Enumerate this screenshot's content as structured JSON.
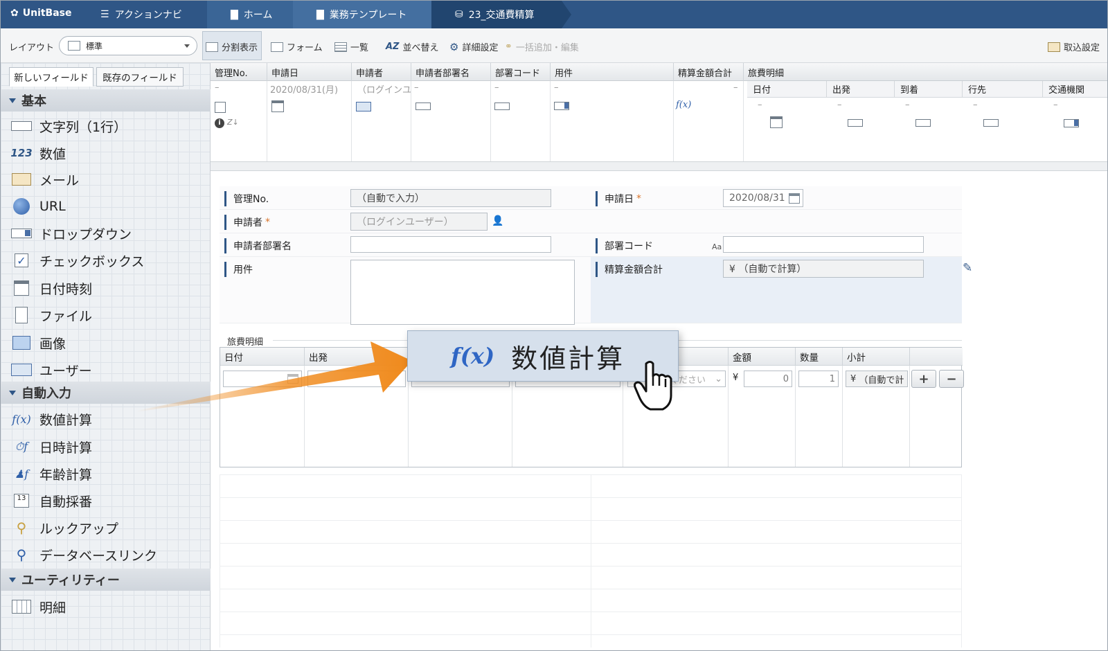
{
  "nav": {
    "brand": "UnitBase",
    "action_navi": "アクションナビ",
    "breadcrumbs": [
      "ホーム",
      "業務テンプレート",
      "23_交通費精算"
    ]
  },
  "toolbar": {
    "layout_label": "レイアウト",
    "layout_value": "標準",
    "split_view": "分割表示",
    "form": "フォーム",
    "list": "一覧",
    "sort": "並べ替え",
    "detail_settings": "詳細設定",
    "bulk_add_edit": "一括追加・編集",
    "import_settings": "取込設定"
  },
  "sidebar": {
    "tab_new": "新しいフィールド",
    "tab_existing": "既存のフィールド",
    "sections": [
      {
        "title": "基本",
        "items": [
          "文字列（1行）",
          "数値",
          "メール",
          "URL",
          "ドロップダウン",
          "チェックボックス",
          "日付時刻",
          "ファイル",
          "画像",
          "ユーザー"
        ]
      },
      {
        "title": "自動入力",
        "items": [
          "数値計算",
          "日時計算",
          "年齢計算",
          "自動採番",
          "ルックアップ",
          "データベースリンク"
        ]
      },
      {
        "title": "ユーティリティー",
        "items": [
          "明細"
        ]
      }
    ]
  },
  "listview": {
    "columns": [
      "管理No.",
      "申請日",
      "申請者",
      "申請者部署名",
      "部署コード",
      "用件",
      "精算金額合計",
      "旅費明細"
    ],
    "sub_columns": [
      "日付",
      "出発",
      "到着",
      "行先",
      "交通機関"
    ],
    "row_dash": "–",
    "row_date": "2020/08/31(月)",
    "row_user": "（ログインユ"
  },
  "form": {
    "kanri_label": "管理No.",
    "kanri_value": "（自動で入力）",
    "shinseibi_label": "申請日",
    "shinseibi_value": "2020/08/31",
    "shinseisha_label": "申請者",
    "shinseisha_value": "（ログインユーザー）",
    "busho_label": "申請者部署名",
    "busho_code_label": "部署コード",
    "busho_code_hint": "Aa",
    "youken_label": "用件",
    "seisan_label": "精算金額合計",
    "seisan_value": "¥ （自動で計算）",
    "required_mark": "*",
    "travel_section": "旅費明細",
    "table_headers": [
      "日付",
      "出発",
      "",
      "",
      "",
      "金額",
      "数量",
      "小計",
      ""
    ],
    "select_placeholder": "ください",
    "yen": "¥",
    "amount": "0",
    "quantity": "1",
    "subtotal": "（自動で計",
    "plus": "+",
    "minus": "−"
  },
  "tooltip": {
    "fx": "f(x)",
    "label": "数値計算"
  },
  "colors": {
    "nav_bg": "#2f5686",
    "accent_arrow": "#f08a1c",
    "required": "#d9742a",
    "tooltip_bg": "#d6e0ec"
  }
}
